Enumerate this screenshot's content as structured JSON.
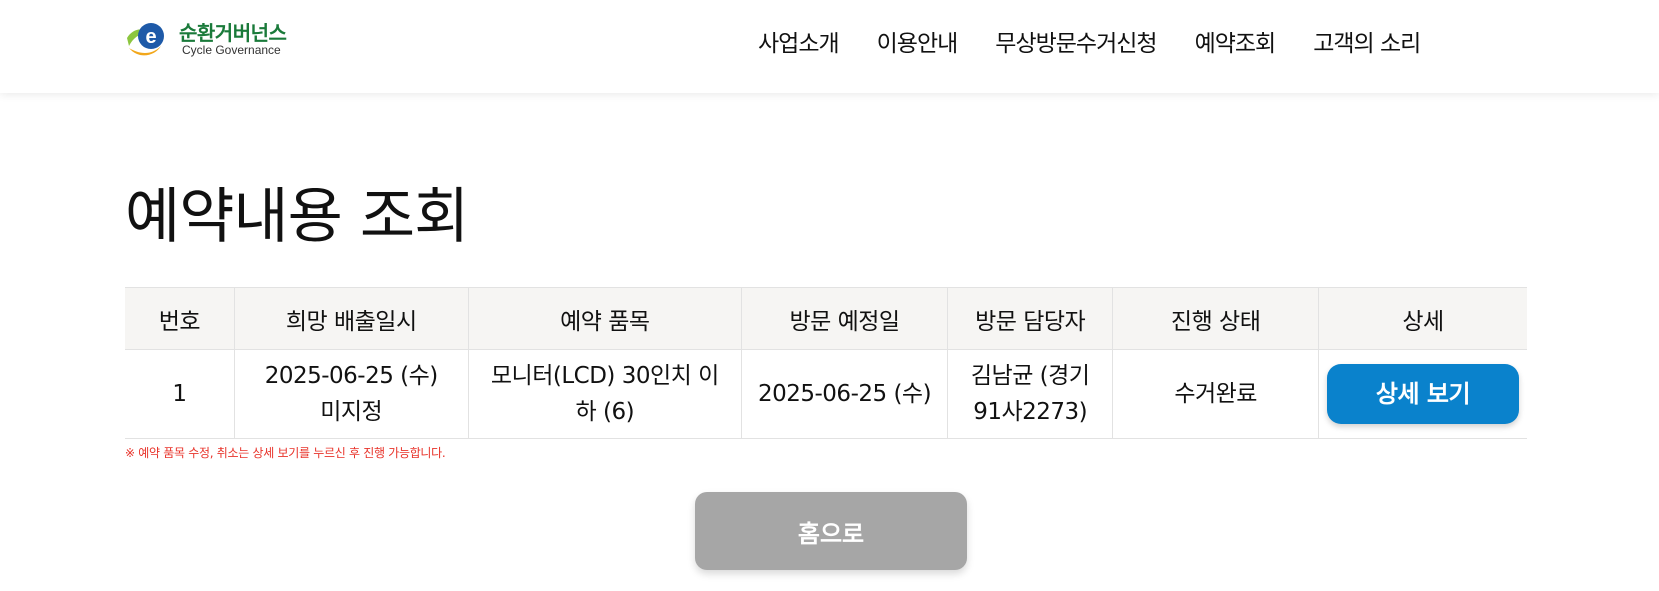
{
  "header": {
    "logo_ko": "순환거버넌스",
    "logo_en": "Cycle Governance",
    "nav": [
      "사업소개",
      "이용안내",
      "무상방문수거신청",
      "예약조회",
      "고객의 소리"
    ]
  },
  "page_title": "예약내용 조회",
  "table": {
    "columns": [
      "번호",
      "희망 배출일시",
      "예약 품목",
      "방문 예정일",
      "방문 담당자",
      "진행 상태",
      "상세"
    ],
    "rows": [
      {
        "no": "1",
        "desired_date_line1": "2025-06-25 (수)",
        "desired_date_line2": "미지정",
        "item_line1": "모니터(LCD) 30인치 이",
        "item_line2": "하 (6)",
        "visit_date": "2025-06-25 (수)",
        "staff_line1": "김남균 (경기",
        "staff_line2": "91사2273)",
        "status": "수거완료",
        "detail_button": "상세 보기"
      }
    ]
  },
  "notice": "※ 예약 품목 수정, 취소는 상세 보기를 누르신 후 진행 가능합니다.",
  "home_button": "홈으로",
  "colors": {
    "accent_blue": "#0a82cc",
    "status_blue": "#1e5aa8",
    "notice_red": "#e8332a",
    "logo_green": "#1a7a3a",
    "home_gray": "#a6a6a6"
  }
}
